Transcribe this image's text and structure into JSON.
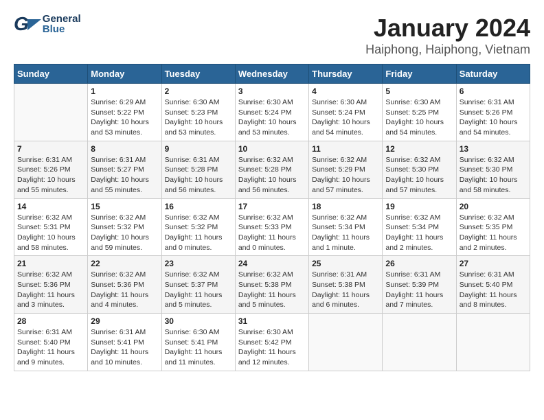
{
  "header": {
    "logo_general": "General",
    "logo_blue": "Blue",
    "title": "January 2024",
    "subtitle": "Haiphong, Haiphong, Vietnam"
  },
  "columns": [
    "Sunday",
    "Monday",
    "Tuesday",
    "Wednesday",
    "Thursday",
    "Friday",
    "Saturday"
  ],
  "weeks": [
    [
      {
        "num": "",
        "info": ""
      },
      {
        "num": "1",
        "info": "Sunrise: 6:29 AM\nSunset: 5:22 PM\nDaylight: 10 hours\nand 53 minutes."
      },
      {
        "num": "2",
        "info": "Sunrise: 6:30 AM\nSunset: 5:23 PM\nDaylight: 10 hours\nand 53 minutes."
      },
      {
        "num": "3",
        "info": "Sunrise: 6:30 AM\nSunset: 5:24 PM\nDaylight: 10 hours\nand 53 minutes."
      },
      {
        "num": "4",
        "info": "Sunrise: 6:30 AM\nSunset: 5:24 PM\nDaylight: 10 hours\nand 54 minutes."
      },
      {
        "num": "5",
        "info": "Sunrise: 6:30 AM\nSunset: 5:25 PM\nDaylight: 10 hours\nand 54 minutes."
      },
      {
        "num": "6",
        "info": "Sunrise: 6:31 AM\nSunset: 5:26 PM\nDaylight: 10 hours\nand 54 minutes."
      }
    ],
    [
      {
        "num": "7",
        "info": "Sunrise: 6:31 AM\nSunset: 5:26 PM\nDaylight: 10 hours\nand 55 minutes."
      },
      {
        "num": "8",
        "info": "Sunrise: 6:31 AM\nSunset: 5:27 PM\nDaylight: 10 hours\nand 55 minutes."
      },
      {
        "num": "9",
        "info": "Sunrise: 6:31 AM\nSunset: 5:28 PM\nDaylight: 10 hours\nand 56 minutes."
      },
      {
        "num": "10",
        "info": "Sunrise: 6:32 AM\nSunset: 5:28 PM\nDaylight: 10 hours\nand 56 minutes."
      },
      {
        "num": "11",
        "info": "Sunrise: 6:32 AM\nSunset: 5:29 PM\nDaylight: 10 hours\nand 57 minutes."
      },
      {
        "num": "12",
        "info": "Sunrise: 6:32 AM\nSunset: 5:30 PM\nDaylight: 10 hours\nand 57 minutes."
      },
      {
        "num": "13",
        "info": "Sunrise: 6:32 AM\nSunset: 5:30 PM\nDaylight: 10 hours\nand 58 minutes."
      }
    ],
    [
      {
        "num": "14",
        "info": "Sunrise: 6:32 AM\nSunset: 5:31 PM\nDaylight: 10 hours\nand 58 minutes."
      },
      {
        "num": "15",
        "info": "Sunrise: 6:32 AM\nSunset: 5:32 PM\nDaylight: 10 hours\nand 59 minutes."
      },
      {
        "num": "16",
        "info": "Sunrise: 6:32 AM\nSunset: 5:32 PM\nDaylight: 11 hours\nand 0 minutes."
      },
      {
        "num": "17",
        "info": "Sunrise: 6:32 AM\nSunset: 5:33 PM\nDaylight: 11 hours\nand 0 minutes."
      },
      {
        "num": "18",
        "info": "Sunrise: 6:32 AM\nSunset: 5:34 PM\nDaylight: 11 hours\nand 1 minute."
      },
      {
        "num": "19",
        "info": "Sunrise: 6:32 AM\nSunset: 5:34 PM\nDaylight: 11 hours\nand 2 minutes."
      },
      {
        "num": "20",
        "info": "Sunrise: 6:32 AM\nSunset: 5:35 PM\nDaylight: 11 hours\nand 2 minutes."
      }
    ],
    [
      {
        "num": "21",
        "info": "Sunrise: 6:32 AM\nSunset: 5:36 PM\nDaylight: 11 hours\nand 3 minutes."
      },
      {
        "num": "22",
        "info": "Sunrise: 6:32 AM\nSunset: 5:36 PM\nDaylight: 11 hours\nand 4 minutes."
      },
      {
        "num": "23",
        "info": "Sunrise: 6:32 AM\nSunset: 5:37 PM\nDaylight: 11 hours\nand 5 minutes."
      },
      {
        "num": "24",
        "info": "Sunrise: 6:32 AM\nSunset: 5:38 PM\nDaylight: 11 hours\nand 5 minutes."
      },
      {
        "num": "25",
        "info": "Sunrise: 6:31 AM\nSunset: 5:38 PM\nDaylight: 11 hours\nand 6 minutes."
      },
      {
        "num": "26",
        "info": "Sunrise: 6:31 AM\nSunset: 5:39 PM\nDaylight: 11 hours\nand 7 minutes."
      },
      {
        "num": "27",
        "info": "Sunrise: 6:31 AM\nSunset: 5:40 PM\nDaylight: 11 hours\nand 8 minutes."
      }
    ],
    [
      {
        "num": "28",
        "info": "Sunrise: 6:31 AM\nSunset: 5:40 PM\nDaylight: 11 hours\nand 9 minutes."
      },
      {
        "num": "29",
        "info": "Sunrise: 6:31 AM\nSunset: 5:41 PM\nDaylight: 11 hours\nand 10 minutes."
      },
      {
        "num": "30",
        "info": "Sunrise: 6:30 AM\nSunset: 5:41 PM\nDaylight: 11 hours\nand 11 minutes."
      },
      {
        "num": "31",
        "info": "Sunrise: 6:30 AM\nSunset: 5:42 PM\nDaylight: 11 hours\nand 12 minutes."
      },
      {
        "num": "",
        "info": ""
      },
      {
        "num": "",
        "info": ""
      },
      {
        "num": "",
        "info": ""
      }
    ]
  ]
}
